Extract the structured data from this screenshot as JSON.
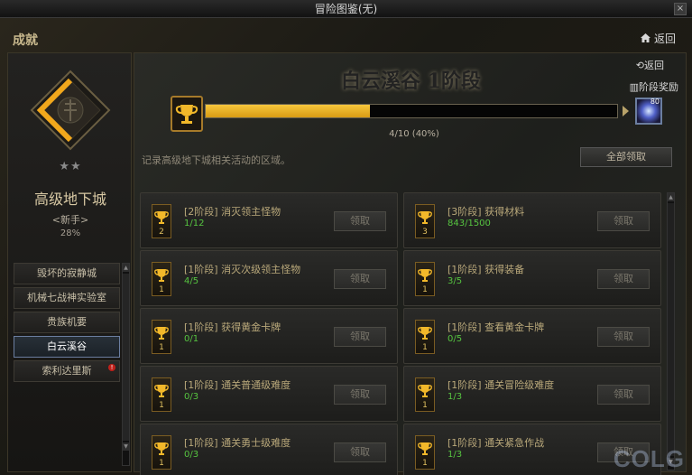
{
  "window": {
    "title": "冒险图鉴(无)",
    "close_label": "×"
  },
  "header": {
    "section_label": "成就",
    "return_label": "返回"
  },
  "left": {
    "stars": "★★",
    "dungeon_name": "高级地下城",
    "difficulty": "<新手>",
    "percent": "28%",
    "nav": [
      {
        "label": "毁坏的寂静城",
        "active": false,
        "alert": false
      },
      {
        "label": "机械七战神实验室",
        "active": false,
        "alert": false
      },
      {
        "label": "贵族机要",
        "active": false,
        "alert": false
      },
      {
        "label": "白云溪谷",
        "active": true,
        "alert": false
      },
      {
        "label": "索利达里斯",
        "active": false,
        "alert": true
      }
    ]
  },
  "main": {
    "back_label": "返回",
    "stage_title": "白云溪谷 1阶段",
    "stage_reward_label": "阶段奖励",
    "progress": {
      "text": "4/10 (40%)",
      "fraction": 0.4
    },
    "reward_count": "80",
    "description": "记录高级地下城相关活动的区域。",
    "claim_all_label": "全部领取",
    "cards": [
      {
        "cup": "2",
        "title": "[2阶段] 消灭领主怪物",
        "count": "1/12",
        "claim": "领取"
      },
      {
        "cup": "3",
        "title": "[3阶段] 获得材料",
        "count": "843/1500",
        "claim": "领取"
      },
      {
        "cup": "1",
        "title": "[1阶段] 消灭次级领主怪物",
        "count": "4/5",
        "claim": "领取"
      },
      {
        "cup": "1",
        "title": "[1阶段] 获得装备",
        "count": "3/5",
        "claim": "领取"
      },
      {
        "cup": "1",
        "title": "[1阶段] 获得黄金卡牌",
        "count": "0/1",
        "claim": "领取"
      },
      {
        "cup": "1",
        "title": "[1阶段] 查看黄金卡牌",
        "count": "0/5",
        "claim": "领取"
      },
      {
        "cup": "1",
        "title": "[1阶段] 通关普通级难度",
        "count": "0/3",
        "claim": "领取"
      },
      {
        "cup": "1",
        "title": "[1阶段] 通关冒险级难度",
        "count": "1/3",
        "claim": "领取"
      },
      {
        "cup": "1",
        "title": "[1阶段] 通关勇士级难度",
        "count": "0/3",
        "claim": "领取"
      },
      {
        "cup": "1",
        "title": "[1阶段] 通关紧急作战",
        "count": "1/3",
        "claim": "领取"
      }
    ]
  },
  "watermark": "COLG",
  "colors": {
    "accent_gold": "#f7c73c",
    "progress_green": "#56c440",
    "active_nav_border": "#6b7ea0"
  }
}
